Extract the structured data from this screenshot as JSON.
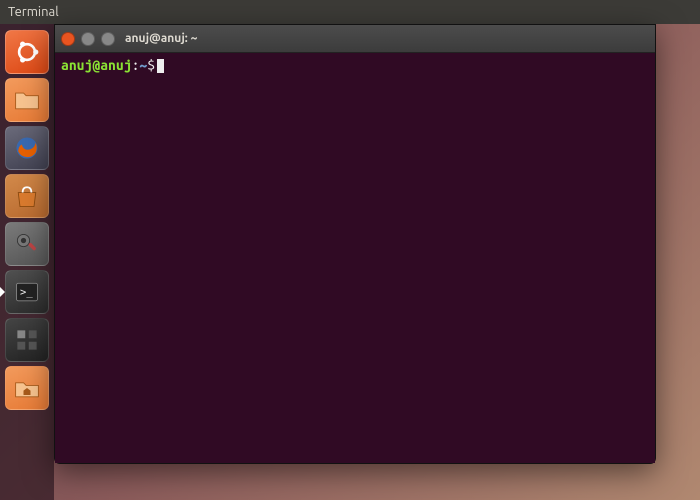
{
  "menubar": {
    "title": "Terminal"
  },
  "launcher": {
    "items": [
      {
        "name": "dash"
      },
      {
        "name": "files"
      },
      {
        "name": "firefox"
      },
      {
        "name": "software"
      },
      {
        "name": "settings"
      },
      {
        "name": "terminal",
        "active": true
      },
      {
        "name": "workspaces"
      },
      {
        "name": "home"
      }
    ]
  },
  "window": {
    "title": "anuj@anuj: ~"
  },
  "terminal": {
    "prompt_user": "anuj@anuj",
    "prompt_sep1": ":",
    "prompt_path": "~",
    "prompt_sep2": "$"
  },
  "colors": {
    "terminal_bg": "#300a24",
    "accent": "#dd4814"
  }
}
